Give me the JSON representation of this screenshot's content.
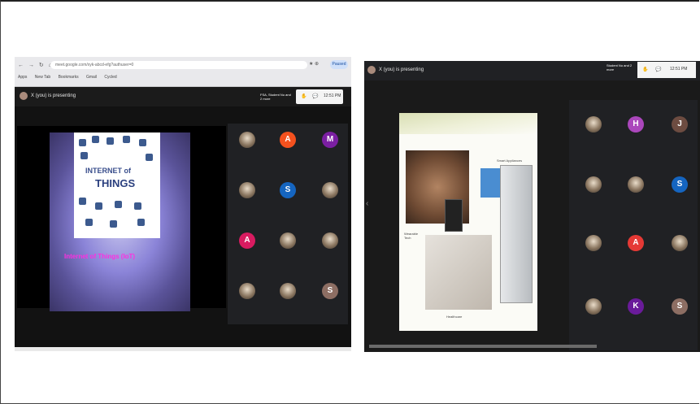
{
  "left_window": {
    "browser": {
      "nav_buttons": "← → ↻ ⌂",
      "url": "meet.google.com/xyk-abcd-efg?authuser=0",
      "url_icons": "★ ⊕",
      "signin": "Paused",
      "bookmarks": [
        "Apps",
        "New Tab",
        "Bookmarks",
        "Gmail",
        "Cycled"
      ]
    },
    "meet": {
      "presenting_label": "X (you) is presenting",
      "name_chip": "FSA, Student Nu and 2 more",
      "time": "12:51 PM",
      "reaction_icon": "✋",
      "chat_icon": "💬"
    },
    "slide": {
      "title_line1": "INTERNET of",
      "title_line2": "THINGS",
      "caption": "Internet of Things (IoT)"
    },
    "participants": [
      {
        "kind": "photo",
        "letter": "",
        "color": ""
      },
      {
        "kind": "letter",
        "letter": "A",
        "color": "#f4511e"
      },
      {
        "kind": "letter",
        "letter": "M",
        "color": "#7b1fa2"
      },
      {
        "kind": "photo",
        "letter": "",
        "color": ""
      },
      {
        "kind": "letter",
        "letter": "S",
        "color": "#1565c0"
      },
      {
        "kind": "photo",
        "letter": "",
        "color": ""
      },
      {
        "kind": "letter",
        "letter": "A",
        "color": "#d81b60"
      },
      {
        "kind": "photo",
        "letter": "",
        "color": ""
      },
      {
        "kind": "photo",
        "letter": "",
        "color": ""
      },
      {
        "kind": "photo",
        "letter": "",
        "color": ""
      },
      {
        "kind": "photo",
        "letter": "",
        "color": ""
      },
      {
        "kind": "letter",
        "letter": "S",
        "color": "#8d6e63"
      }
    ]
  },
  "right_window": {
    "meet": {
      "presenting_label": "X (you) is presenting",
      "name_chip": "Student Nu and 2 more",
      "time": "12:51 PM",
      "reaction_icon": "✋",
      "chat_icon": "💬",
      "prev_arrow": "‹"
    },
    "slide": {
      "smart_appliances": "Smart Appliances",
      "wearable": "Wearable Tech",
      "healthcare": "Healthcare"
    },
    "participants": [
      {
        "kind": "photo",
        "letter": "",
        "color": ""
      },
      {
        "kind": "letter",
        "letter": "H",
        "color": "#ab47bc"
      },
      {
        "kind": "letter",
        "letter": "J",
        "color": "#6d4c41"
      },
      {
        "kind": "photo",
        "letter": "",
        "color": ""
      },
      {
        "kind": "photo",
        "letter": "",
        "color": ""
      },
      {
        "kind": "letter",
        "letter": "S",
        "color": "#1565c0"
      },
      {
        "kind": "photo",
        "letter": "",
        "color": ""
      },
      {
        "kind": "letter",
        "letter": "A",
        "color": "#e53935"
      },
      {
        "kind": "photo",
        "letter": "",
        "color": ""
      },
      {
        "kind": "photo",
        "letter": "",
        "color": ""
      },
      {
        "kind": "letter",
        "letter": "K",
        "color": "#6a1b9a"
      },
      {
        "kind": "letter",
        "letter": "S",
        "color": "#8d6e63"
      }
    ]
  }
}
